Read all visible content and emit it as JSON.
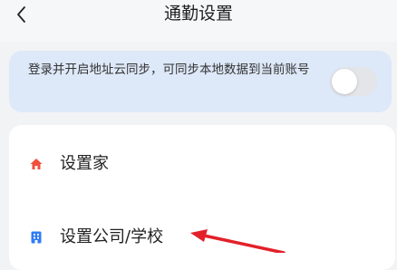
{
  "header": {
    "title": "通勤设置",
    "back_icon": "chevron-left-icon"
  },
  "sync_banner": {
    "text": "登录并开启地址云同步，可同步本地数据到当前账号",
    "toggle_on": false
  },
  "settings_list": {
    "items": [
      {
        "label": "设置家",
        "icon": "home-icon",
        "icon_color": "#f0503c"
      },
      {
        "label": "设置公司/学校",
        "icon": "building-icon",
        "icon_color": "#2f7cf6"
      }
    ]
  },
  "annotation": {
    "arrow_color": "#e3202a"
  }
}
